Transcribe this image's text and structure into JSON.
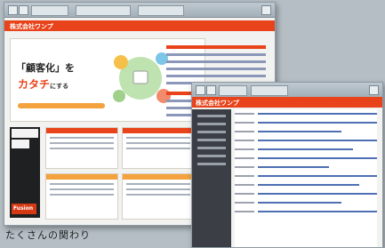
{
  "back_window": {
    "site_logo": "株式会社ワンプ",
    "hero": {
      "headline": "「顧客化」を",
      "headline_suffix": "",
      "subhead": "カタチ",
      "subhead_suffix": "にする"
    },
    "footer_logo": "Fusion"
  },
  "front_window": {
    "site_logo": "株式会社ワンプ"
  },
  "caption": "たくさんの関わり"
}
